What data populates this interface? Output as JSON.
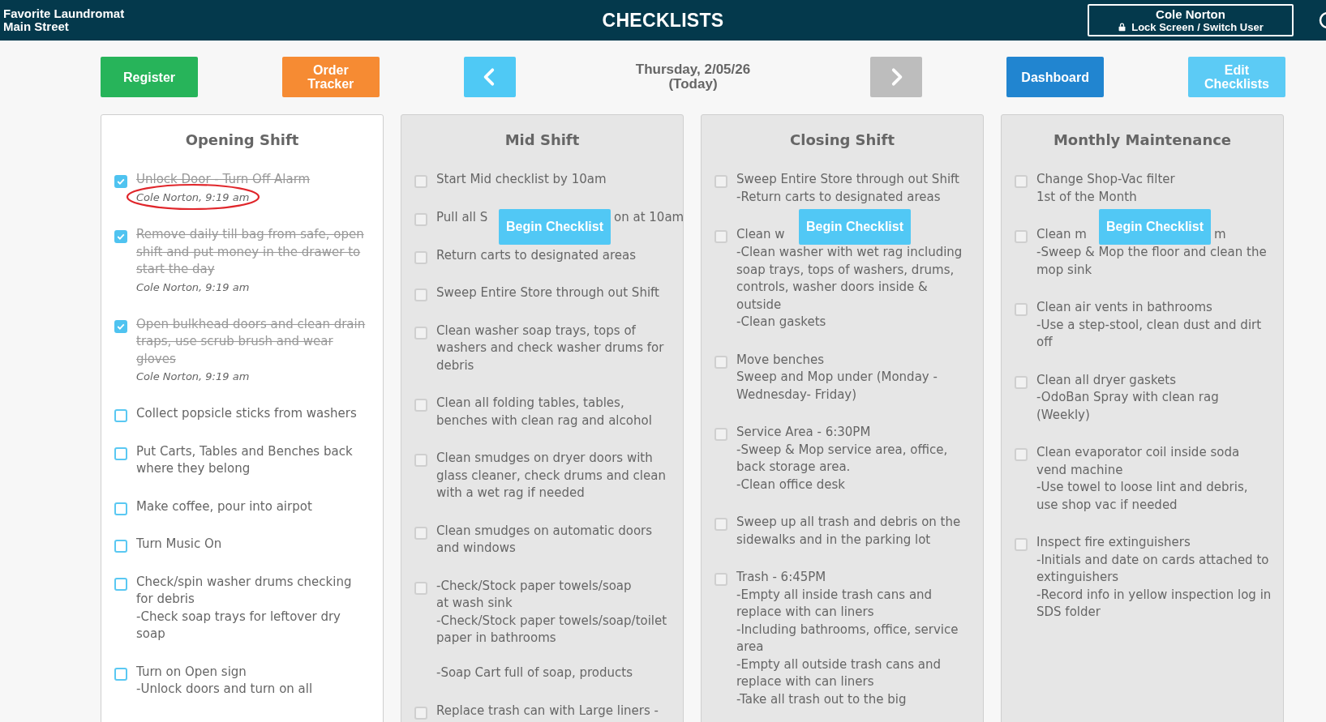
{
  "header": {
    "store_name": "Favorite Laundromat",
    "store_location": "Main Street",
    "title": "CHECKLISTS",
    "user": {
      "name": "Cole Norton",
      "action": "Lock Screen / Switch User"
    }
  },
  "toolbar": {
    "left_buttons": [
      {
        "label": "Register",
        "color": "#27b45a"
      },
      {
        "label": "Order Tracker",
        "color": "#f68b33"
      }
    ],
    "prev": {
      "disabled": false
    },
    "date": {
      "line1": "Thursday, 2/05/26",
      "line2": "(Today)"
    },
    "next": {
      "disabled": true
    },
    "right_buttons": [
      {
        "label": "Dashboard",
        "color": "#2185d0"
      },
      {
        "label": "Edit Checklists",
        "color": "#5ccbf5"
      }
    ]
  },
  "columns": [
    {
      "title": "Opening Shift",
      "active": true,
      "items": [
        {
          "checked": true,
          "text": "Unlock Door - Turn Off Alarm",
          "signoff": "Cole Norton, 9:19 am",
          "highlighted": true
        },
        {
          "checked": true,
          "text": "Remove daily till bag from safe, open shift and put money in the drawer to start the day",
          "signoff": "Cole Norton, 9:19 am"
        },
        {
          "checked": true,
          "text": "Open bulkhead doors and clean drain traps, use scrub brush and wear gloves",
          "signoff": "Cole Norton, 9:19 am"
        },
        {
          "checked": false,
          "text": "Collect popsicle sticks from washers"
        },
        {
          "checked": false,
          "text": "Put Carts, Tables and Benches back where they belong"
        },
        {
          "checked": false,
          "text": "Make coffee, pour into airpot"
        },
        {
          "checked": false,
          "text": "Turn Music On"
        },
        {
          "checked": false,
          "text": "Check/spin washer drums checking for debris\n-Check soap trays for leftover dry soap"
        },
        {
          "checked": false,
          "text": "Turn on Open sign\n-Unlock doors and turn on all"
        }
      ]
    },
    {
      "title": "Mid Shift",
      "active": false,
      "begin_button": "Begin Checklist",
      "items": [
        {
          "checked": false,
          "text": "Start Mid checklist by 10am"
        },
        {
          "checked": false,
          "lead": "Pull all S",
          "tail": "on at 10am"
        },
        {
          "checked": false,
          "text": "Return carts to designated areas"
        },
        {
          "checked": false,
          "text": "Sweep Entire Store through out Shift"
        },
        {
          "checked": false,
          "text": "Clean washer soap trays, tops of washers and check washer drums for debris"
        },
        {
          "checked": false,
          "text": "Clean all folding tables, tables, benches with clean rag and alcohol"
        },
        {
          "checked": false,
          "text": "Clean smudges on dryer doors with glass cleaner, check drums and clean with a wet rag if needed"
        },
        {
          "checked": false,
          "text": "Clean smudges on automatic doors and windows"
        },
        {
          "checked": false,
          "text": "-Check/Stock paper towels/soap\nat wash sink\n-Check/Stock paper towels/soap/toilet paper in bathrooms\n\n-Soap Cart full of soap, products"
        },
        {
          "checked": false,
          "text": "Replace trash can with Large liners -"
        }
      ]
    },
    {
      "title": "Closing Shift",
      "active": false,
      "begin_button": "Begin Checklist",
      "items": [
        {
          "checked": false,
          "text": "Sweep Entire Store through out Shift\n-Return carts to designated areas"
        },
        {
          "checked": false,
          "lead": "Clean w",
          "text": "-Clean washer with wet rag including soap trays, tops of washers, drums, controls, washer doors inside & outside\n-Clean gaskets"
        },
        {
          "checked": false,
          "text": "Move benches\nSweep and Mop under (Monday - Wednesday- Friday)"
        },
        {
          "checked": false,
          "text": "Service Area - 6:30PM\n-Sweep & Mop service area, office, back storage area.\n-Clean office desk"
        },
        {
          "checked": false,
          "text": "Sweep up all trash and debris on the sidewalks and in the parking lot"
        },
        {
          "checked": false,
          "text": "Trash -  6:45PM\n-Empty all inside trash cans and replace with can liners\n-Including bathrooms, office, service area\n-Empty all outside trash cans and replace with can liners\n-Take all trash out to the big"
        }
      ]
    },
    {
      "title": "Monthly Maintenance",
      "active": false,
      "begin_button": "Begin Checklist",
      "items": [
        {
          "checked": false,
          "text": "Change Shop-Vac filter\n1st of the Month"
        },
        {
          "checked": false,
          "lead": "Clean m",
          "tail": "m",
          "text": "-Sweep & Mop the floor and clean the mop sink"
        },
        {
          "checked": false,
          "text": "Clean air vents in bathrooms\n-Use a step-stool, clean dust and dirt off"
        },
        {
          "checked": false,
          "text": "Clean all dryer gaskets\n-OdoBan Spray with clean rag (Weekly)"
        },
        {
          "checked": false,
          "text": "Clean evaporator coil inside soda vend machine\n-Use towel to loose lint and debris, use shop vac if needed"
        },
        {
          "checked": false,
          "text": "Inspect fire extinguishers\n-Initials and date on cards attached to extinguishers\n-Record info in yellow inspection log in SDS folder"
        }
      ]
    }
  ]
}
